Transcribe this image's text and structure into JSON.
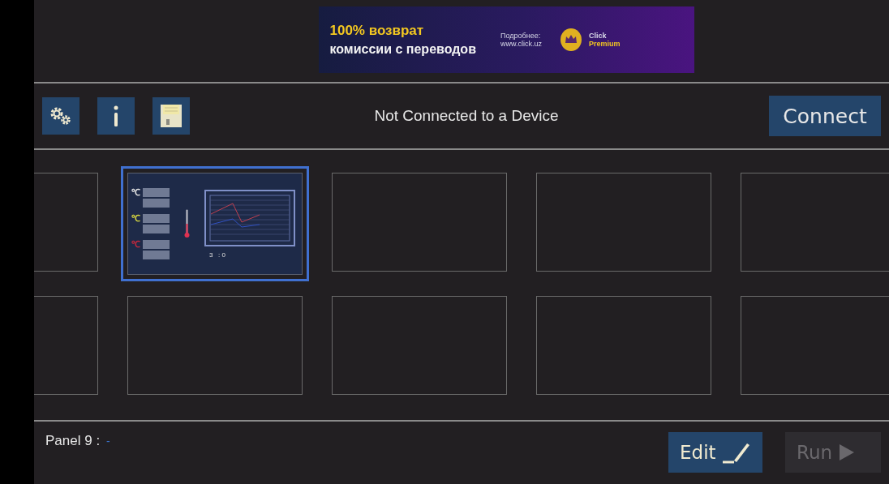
{
  "ad": {
    "headline": "100% возврат",
    "subline": "комиссии с переводов",
    "more_label": "Подробнее:",
    "url": "www.click.uz",
    "brand_top": "Click",
    "brand_bottom": "Premium"
  },
  "toolbar": {
    "status": "Not Connected to a Device",
    "connect_button": "Connect"
  },
  "panels": [
    {
      "kind": "empty",
      "selected": false
    },
    {
      "kind": "thumbnail",
      "selected": true,
      "units": [
        {
          "label": "℃",
          "color": "#e8e8e8"
        },
        {
          "label": "℃",
          "color": "#d8d840"
        },
        {
          "label": "℃",
          "color": "#c8283c"
        }
      ],
      "reading": "3   : 0"
    },
    {
      "kind": "empty",
      "selected": false
    },
    {
      "kind": "empty",
      "selected": false
    },
    {
      "kind": "empty",
      "selected": false
    },
    {
      "kind": "empty",
      "selected": false
    },
    {
      "kind": "empty",
      "selected": false
    },
    {
      "kind": "empty",
      "selected": false
    },
    {
      "kind": "empty",
      "selected": false
    },
    {
      "kind": "empty",
      "selected": false
    }
  ],
  "footer": {
    "panel_label": "Panel 9 :",
    "panel_value": "-",
    "edit_button": "Edit",
    "run_button": {
      "label": "Run",
      "disabled": true
    }
  }
}
